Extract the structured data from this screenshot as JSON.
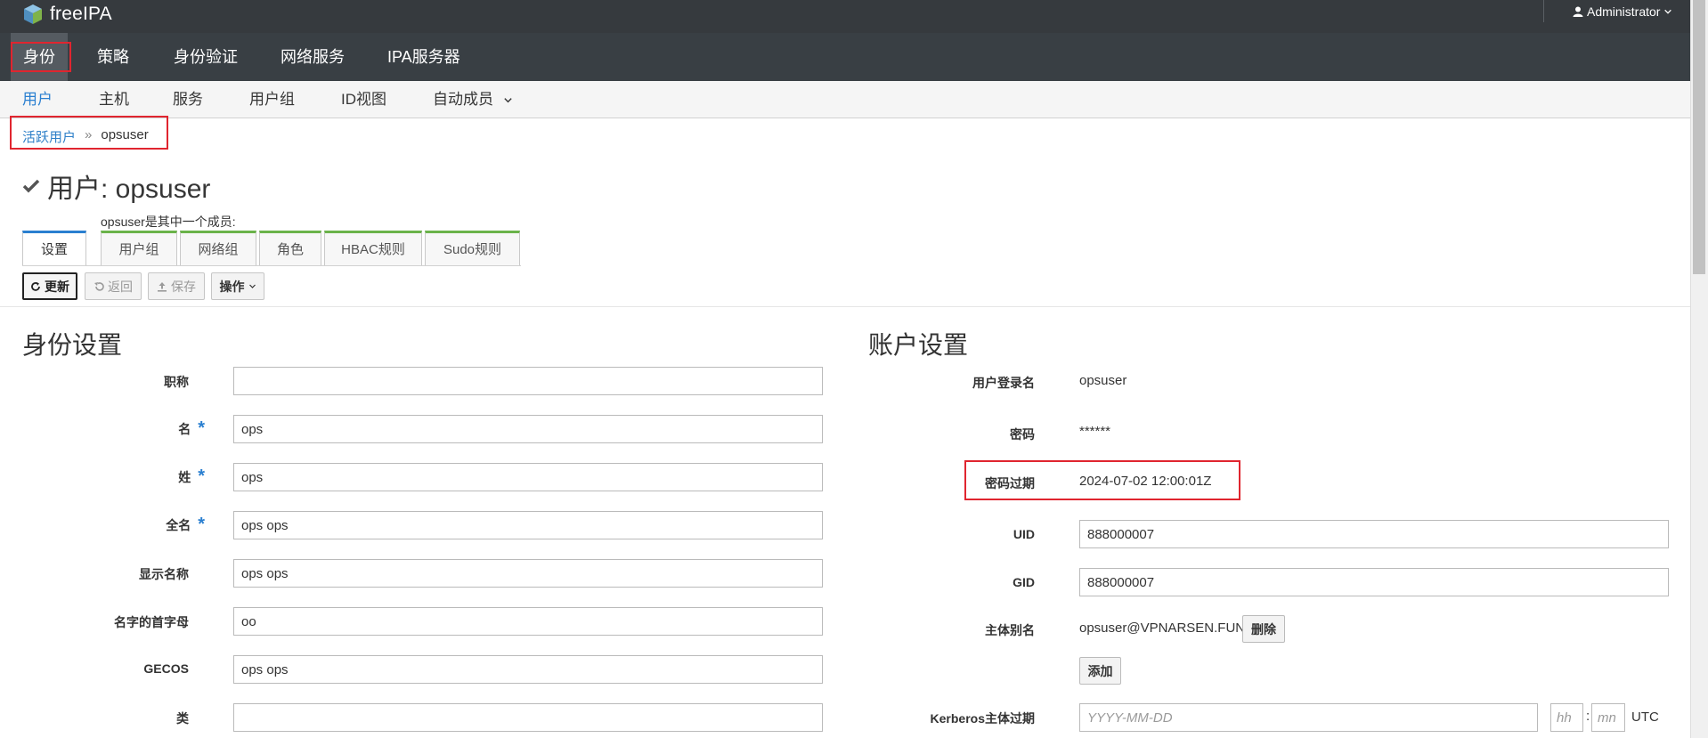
{
  "header": {
    "brand": "freeIPA",
    "user": "Administrator"
  },
  "main_nav": [
    {
      "label": "身份",
      "active": true
    },
    {
      "label": "策略"
    },
    {
      "label": "身份验证"
    },
    {
      "label": "网络服务"
    },
    {
      "label": "IPA服务器"
    }
  ],
  "sub_nav": [
    {
      "label": "用户",
      "active": true
    },
    {
      "label": "主机"
    },
    {
      "label": "服务"
    },
    {
      "label": "用户组"
    },
    {
      "label": "ID视图"
    },
    {
      "label": "自动成员"
    }
  ],
  "breadcrumb": {
    "parent": "活跃用户",
    "separator": "»",
    "current": "opsuser"
  },
  "page": {
    "title": "用户: opsuser",
    "member_label": "opsuser是其中一个成员:"
  },
  "tabs": {
    "settings": "设置",
    "members": [
      "用户组",
      "网络组",
      "角色",
      "HBAC规则",
      "Sudo规则"
    ]
  },
  "toolbar": {
    "refresh": "更新",
    "revert": "返回",
    "save": "保存",
    "actions": "操作"
  },
  "identity": {
    "heading": "身份设置",
    "fields": [
      {
        "label": "职称",
        "value": "",
        "required": false
      },
      {
        "label": "名",
        "value": "ops",
        "required": true
      },
      {
        "label": "姓",
        "value": "ops",
        "required": true
      },
      {
        "label": "全名",
        "value": "ops ops",
        "required": true
      },
      {
        "label": "显示名称",
        "value": "ops ops",
        "required": false
      },
      {
        "label": "名字的首字母",
        "value": "oo",
        "required": false
      },
      {
        "label": "GECOS",
        "value": "ops ops",
        "required": false
      },
      {
        "label": "类",
        "value": "",
        "required": false
      }
    ]
  },
  "account": {
    "heading": "账户设置",
    "login_label": "用户登录名",
    "login_value": "opsuser",
    "password_label": "密码",
    "password_value": "******",
    "pwexp_label": "密码过期",
    "pwexp_value": "2024-07-02 12:00:01Z",
    "uid_label": "UID",
    "uid_value": "888000007",
    "gid_label": "GID",
    "gid_value": "888000007",
    "principal_label": "主体别名",
    "principal_value": "opsuser@VPNARSEN.FUN",
    "delete_label": "删除",
    "add_label": "添加",
    "krb_label": "Kerberos主体过期",
    "krb_date_placeholder": "YYYY-MM-DD",
    "krb_hh_placeholder": "hh",
    "krb_mn_placeholder": "mn",
    "time_sep": ":",
    "tz": "UTC"
  },
  "colors": {
    "highlight": "#e0252f",
    "accent": "#2a7fd0",
    "member_tab": "#6ab34a"
  }
}
